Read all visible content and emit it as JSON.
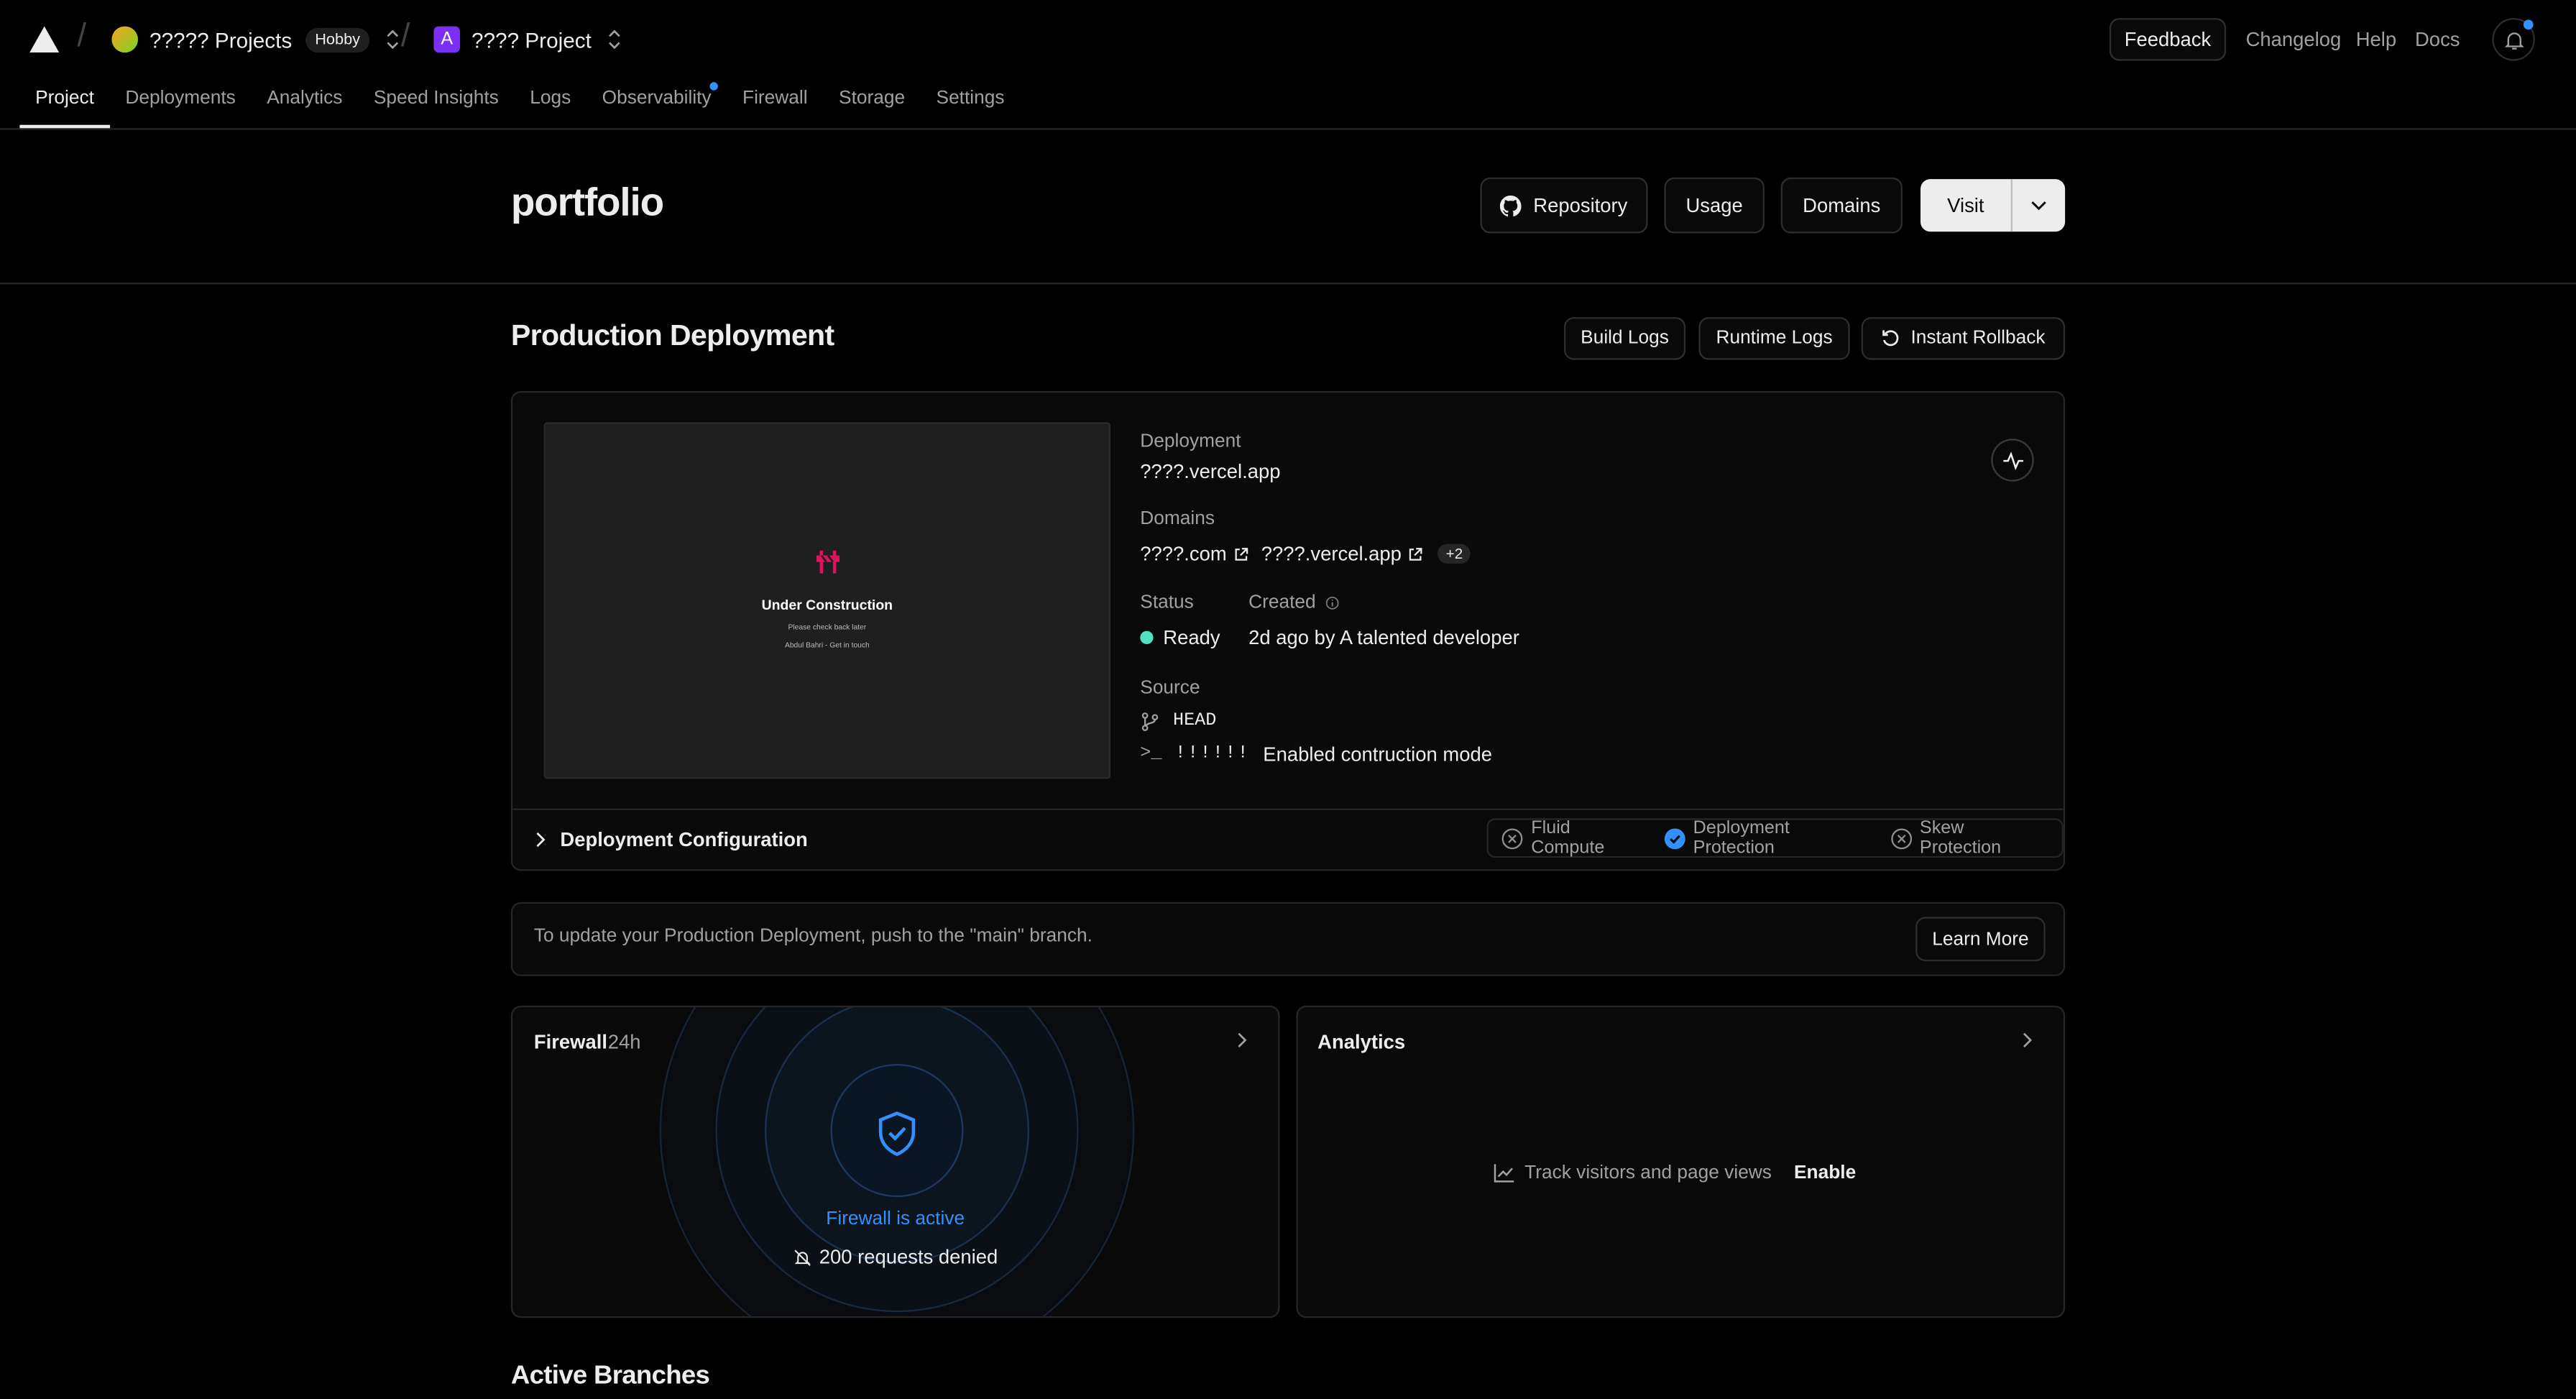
{
  "topbar": {
    "team_name": "????? Projects",
    "team_plan": "Hobby",
    "project_initial": "A",
    "project_name": "???? Project",
    "feedback_label": "Feedback",
    "changelog_label": "Changelog",
    "help_label": "Help",
    "docs_label": "Docs"
  },
  "tabs": [
    {
      "label": "Project",
      "active": true
    },
    {
      "label": "Deployments"
    },
    {
      "label": "Analytics"
    },
    {
      "label": "Speed Insights"
    },
    {
      "label": "Logs"
    },
    {
      "label": "Observability",
      "has_dot": true
    },
    {
      "label": "Firewall"
    },
    {
      "label": "Storage"
    },
    {
      "label": "Settings"
    }
  ],
  "header": {
    "title": "portfolio",
    "repository_label": "Repository",
    "usage_label": "Usage",
    "domains_label": "Domains",
    "visit_label": "Visit"
  },
  "production": {
    "title": "Production Deployment",
    "build_logs_label": "Build Logs",
    "runtime_logs_label": "Runtime Logs",
    "rollback_label": "Instant Rollback",
    "preview": {
      "title": "Under Construction",
      "line1": "Please check back later",
      "line2": "Abdul Bahri - Get in touch"
    },
    "deployment_label": "Deployment",
    "deployment_url": "????.vercel.app",
    "domains_label": "Domains",
    "domains": [
      "????.com",
      "????.vercel.app"
    ],
    "domains_more": "+2",
    "status_label": "Status",
    "status_value": "Ready",
    "status_color": "#50e3c2",
    "created_label": "Created",
    "created_value": "2d ago by A talented developer",
    "source_label": "Source",
    "branch": "HEAD",
    "commit_hash": "!!!!!!",
    "commit_message": "Enabled contruction mode",
    "config_label": "Deployment Configuration",
    "features": [
      {
        "label": "Fluid Compute",
        "enabled": false
      },
      {
        "label": "Deployment Protection",
        "enabled": true
      },
      {
        "label": "Skew Protection",
        "enabled": false
      }
    ]
  },
  "notice": {
    "text": "To update your Production Deployment, push to the \"main\" branch.",
    "learn_more_label": "Learn More"
  },
  "firewall": {
    "title": "Firewall",
    "period": "24h",
    "status": "Firewall is active",
    "requests": "200 requests denied",
    "accent": "#3291ff"
  },
  "analytics": {
    "title": "Analytics",
    "empty_text": "Track visitors and page views",
    "enable_label": "Enable"
  },
  "branches": {
    "title": "Active Branches"
  }
}
